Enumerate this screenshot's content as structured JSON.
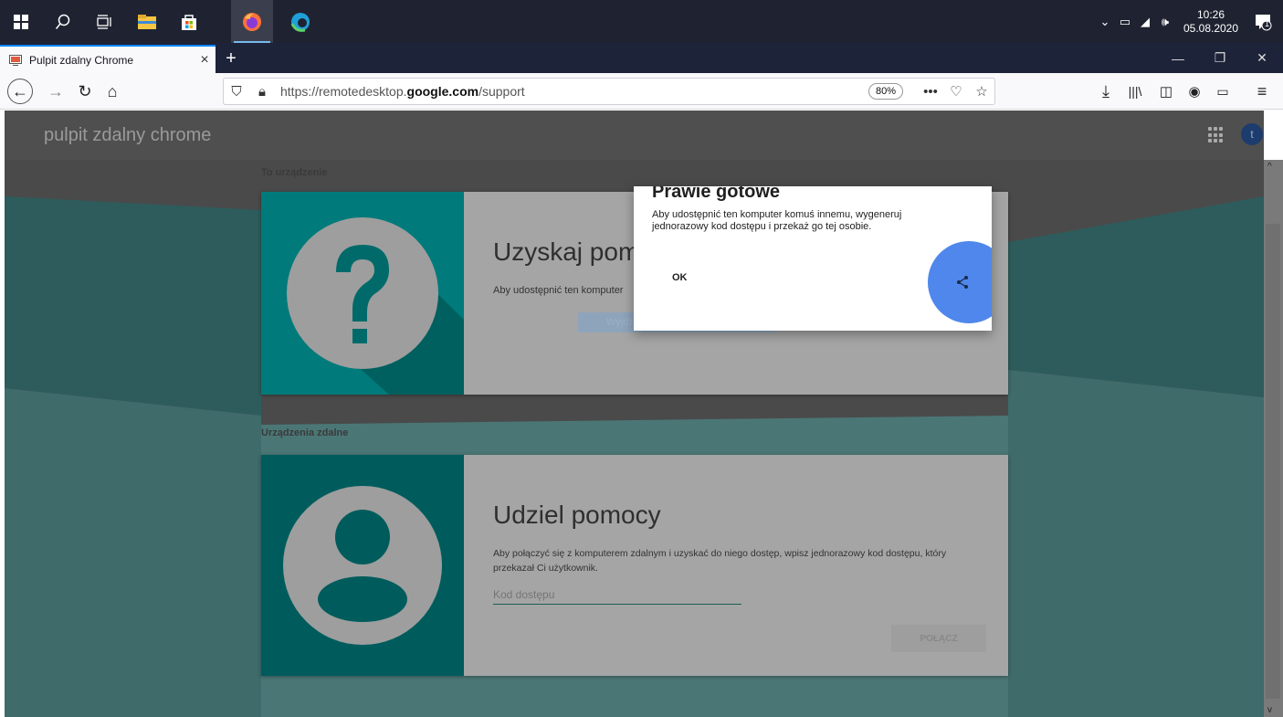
{
  "taskbar": {
    "clock_time": "10:26",
    "clock_date": "05.08.2020",
    "notification_count": "1"
  },
  "browser": {
    "tab_title": "Pulpit zdalny Chrome",
    "url_prefix": "https://remotedesktop.",
    "url_domain": "google.com",
    "url_path": "/support",
    "zoom": "80%"
  },
  "app": {
    "title": "pulpit zdalny chrome",
    "avatar_letter": "t"
  },
  "sections": {
    "this_device_label": "To urządzenie",
    "remote_devices_label": "Urządzenia zdalne"
  },
  "get_help_card": {
    "title": "Uzyskaj pom",
    "description": "Aby udostępnić ten komputer",
    "fullscreen_button": "Wyjdź z trybu pełnoekranowego"
  },
  "give_help_card": {
    "title": "Udziel pomocy",
    "description": "Aby połączyć się z komputerem zdalnym i uzyskać do niego dostęp, wpisz jednorazowy kod dostępu, który przekazał Ci użytkownik.",
    "code_placeholder": "Kod dostępu",
    "connect_button": "POŁĄCZ"
  },
  "dialog": {
    "title": "Prawie gotowe",
    "text": "Aby udostępnić ten komputer komuś innemu, wygeneruj jednorazowy kod dostępu i przekaż go tej osobie.",
    "ok_label": "OK"
  },
  "colors": {
    "taskbar_bg": "#1f2331",
    "teal_dark": "#007a7a",
    "share_blue": "#4f87ec",
    "firefox_accent": "#0a84ff"
  }
}
